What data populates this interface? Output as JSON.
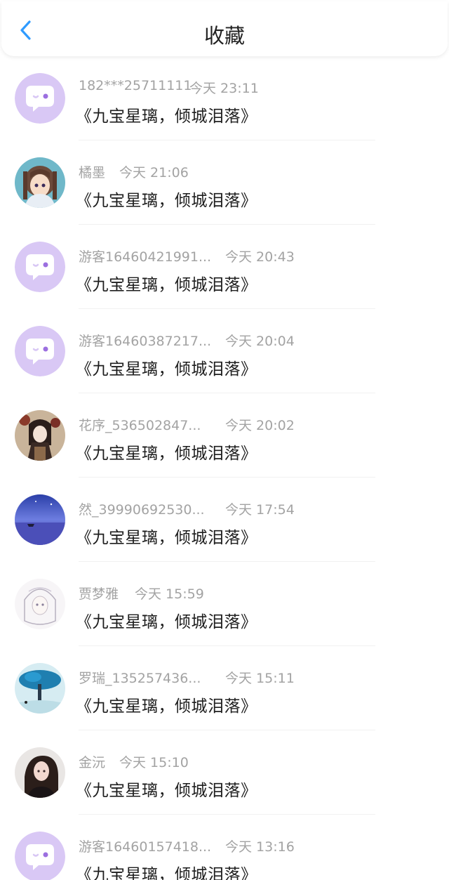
{
  "header": {
    "title": "收藏",
    "back_icon": "chevron-left-icon",
    "accent": "#2f9bff"
  },
  "favorites": [
    {
      "username": "182***25711111",
      "time": "今天 23:11",
      "title": "《九宝星璃，倾城泪落》",
      "avatar": "default-chat-bubble"
    },
    {
      "username": "橘墨",
      "time": "今天 21:06",
      "title": "《九宝星璃，倾城泪落》",
      "avatar": "anime-girl"
    },
    {
      "username": "游客16460421991...",
      "time": "今天 20:43",
      "title": "《九宝星璃，倾城泪落》",
      "avatar": "default-chat-bubble"
    },
    {
      "username": "游客16460387217...",
      "time": "今天 20:04",
      "title": "《九宝星璃，倾城泪落》",
      "avatar": "default-chat-bubble"
    },
    {
      "username": "花序_536502847...",
      "time": "今天 20:02",
      "title": "《九宝星璃，倾城泪落》",
      "avatar": "dark-lolita-girl"
    },
    {
      "username": "然_39990692530...",
      "time": "今天 17:54",
      "title": "《九宝星璃，倾城泪落》",
      "avatar": "night-sky-sea"
    },
    {
      "username": "贾梦雅",
      "time": "今天 15:59",
      "title": "《九宝星璃，倾城泪落》",
      "avatar": "sketch-girl"
    },
    {
      "username": "罗瑞_135257436...",
      "time": "今天 15:11",
      "title": "《九宝星璃，倾城泪落》",
      "avatar": "tree-landscape"
    },
    {
      "username": "金沅",
      "time": "今天 15:10",
      "title": "《九宝星璃，倾城泪落》",
      "avatar": "photo-girl"
    },
    {
      "username": "游客16460157418...",
      "time": "今天 13:16",
      "title": "《九宝星璃，倾城泪落》",
      "avatar": "default-chat-bubble"
    }
  ]
}
